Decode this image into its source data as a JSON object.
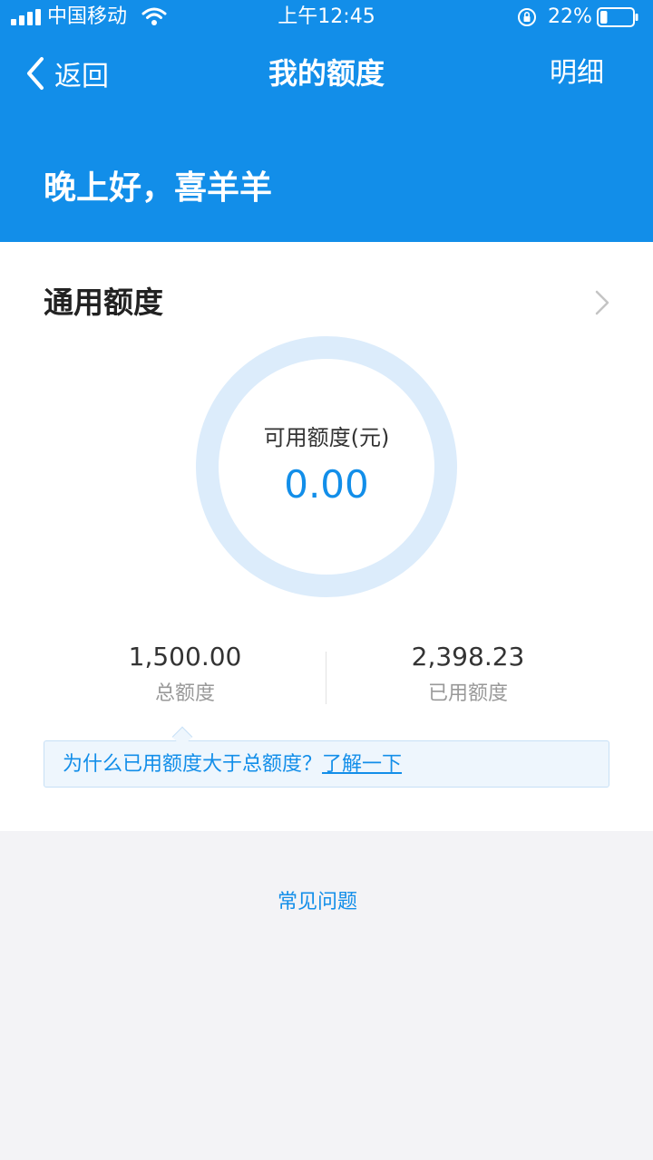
{
  "status_bar": {
    "carrier": "中国移动",
    "time": "上午12:45",
    "battery_percent": "22%",
    "battery_level": 0.22
  },
  "nav": {
    "back_label": "返回",
    "title": "我的额度",
    "detail_label": "明细"
  },
  "greeting": "晚上好，喜羊羊",
  "credit": {
    "section_title": "通用额度",
    "available_label": "可用额度(元)",
    "available_value": "0.00",
    "total_value": "1,500.00",
    "total_label": "总额度",
    "used_value": "2,398.23",
    "used_label": "已用额度"
  },
  "tip": {
    "question": "为什么已用额度大于总额度？",
    "link": "了解一下"
  },
  "faq_label": "常见问题",
  "colors": {
    "primary": "#128ee9",
    "ring": "#dcecfb",
    "background": "#f3f3f6"
  }
}
